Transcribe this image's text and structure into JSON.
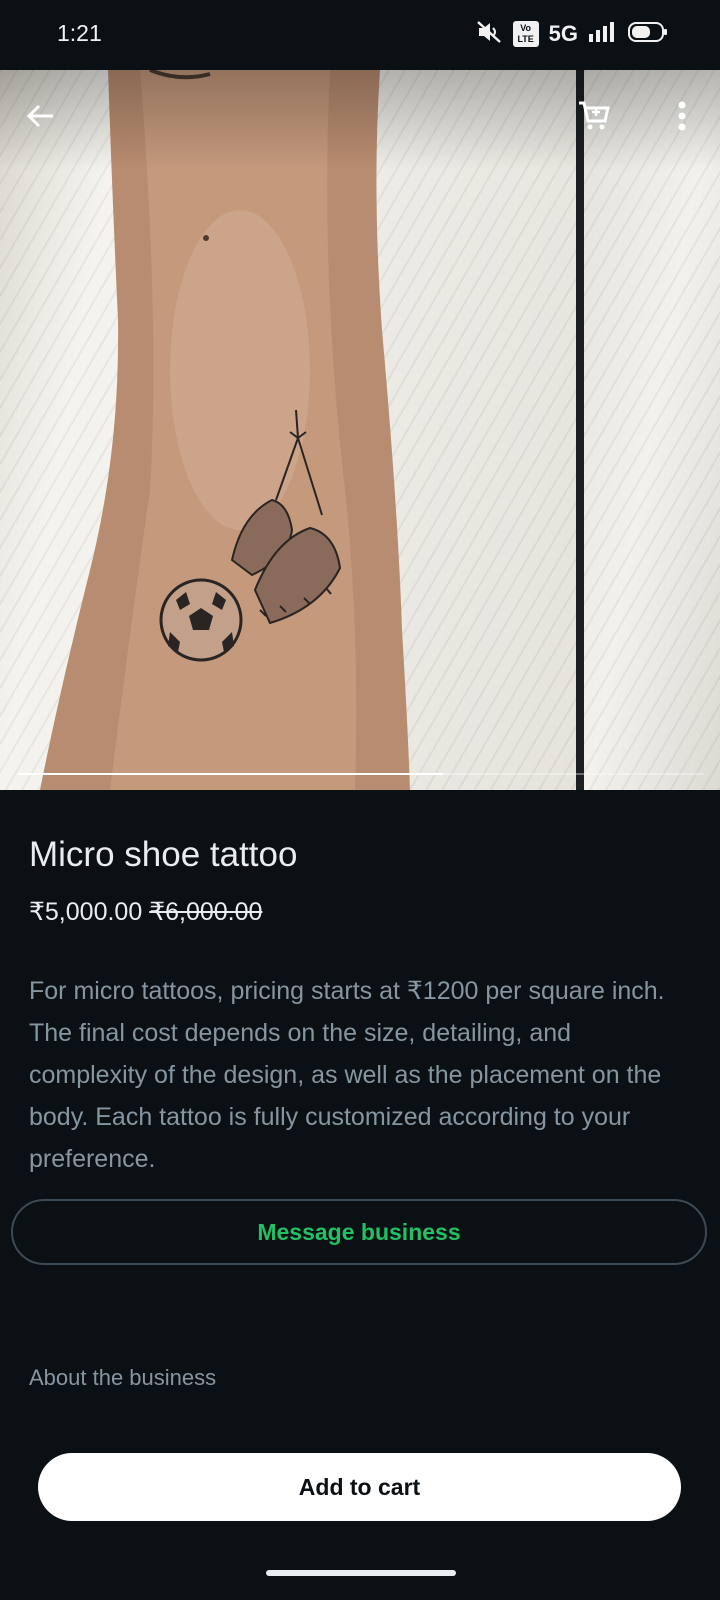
{
  "status_bar": {
    "time": "1:21",
    "volte_line1": "Vo",
    "volte_line2": "LTE",
    "network": "5G",
    "icons": [
      "mute-icon",
      "volte-icon",
      "signal-icon",
      "battery-icon"
    ]
  },
  "gallery": {
    "images": [
      "tattoo-photo-main",
      "tattoo-photo-next"
    ],
    "progress": 0.62,
    "actions": [
      "back-arrow-icon",
      "cart-icon",
      "more-vert-icon"
    ]
  },
  "product": {
    "title": "Micro shoe tattoo",
    "price": "₹5,000.00",
    "original_price": "₹6,000.00",
    "description": "For micro tattoos, pricing starts at ₹1200 per square inch. The final cost depends on the size, detailing, and complexity of the design, as well as the placement on the body. Each tattoo is fully customized according to your preference."
  },
  "actions": {
    "message_business": "Message business",
    "about_business": "About the business",
    "add_to_cart": "Add to cart"
  },
  "colors": {
    "background": "#0b1014",
    "accent_green": "#21c063",
    "muted_text": "#8696a0"
  }
}
